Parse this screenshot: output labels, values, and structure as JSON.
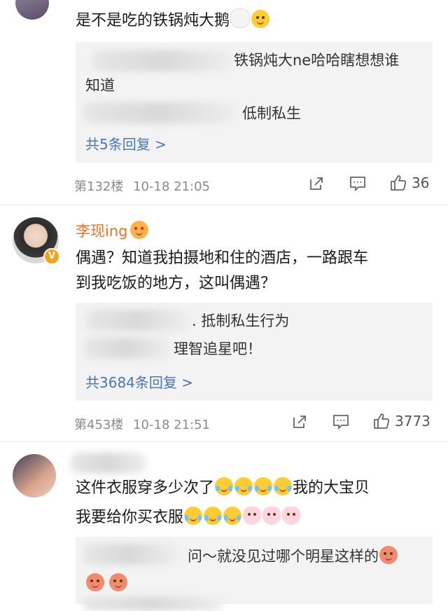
{
  "comments": [
    {
      "text_line1": "是不是吃的铁锅炖大鹅",
      "replies": [
        {
          "line1": "铁锅炖大ne哈哈瞎想想谁",
          "line2": "知道"
        },
        {
          "line1": "低制私生"
        }
      ],
      "more_replies": "共5条回复 >",
      "floor": "第132楼",
      "time": "10-18 21:05",
      "likes": "36"
    },
    {
      "username": "李现ing",
      "text_line1": "偶遇？知道我拍摄地和住的酒店，一路跟车",
      "text_line2": "到我吃饭的地方，这叫偶遇？",
      "replies": [
        {
          "line1": ". 抵制私生行为"
        },
        {
          "line1": "理智追星吧！"
        }
      ],
      "more_replies": "共3684条回复 >",
      "floor": "第453楼",
      "time": "10-18 21:51",
      "likes": "3773"
    },
    {
      "text_line1": "这件衣服穿多少次了",
      "text_line1_tail": "我的大宝贝",
      "text_line2": "我要给你买衣服",
      "replies": [
        {
          "line1": "问～就没见过哪个明星这样的"
        }
      ]
    }
  ]
}
